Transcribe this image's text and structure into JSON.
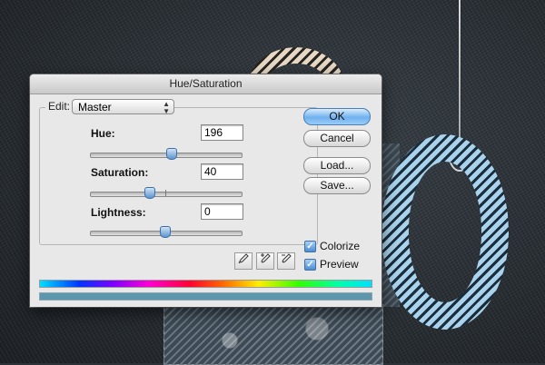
{
  "dialog": {
    "title": "Hue/Saturation",
    "edit_label": "Edit:",
    "edit_value": "Master",
    "hue": {
      "label": "Hue:",
      "value": "196",
      "slider_fraction": 0.54
    },
    "saturation": {
      "label": "Saturation:",
      "value": "40",
      "slider_fraction": 0.4
    },
    "lightness": {
      "label": "Lightness:",
      "value": "0",
      "slider_fraction": 0.5
    },
    "buttons": {
      "ok": "OK",
      "cancel": "Cancel",
      "load": "Load...",
      "save": "Save..."
    },
    "colorize": {
      "label": "Colorize",
      "checked": true
    },
    "preview": {
      "label": "Preview",
      "checked": true
    },
    "icons": [
      "eyedropper-icon",
      "eyedropper-plus-icon",
      "eyedropper-minus-icon"
    ]
  },
  "colors": {
    "accent": "#6fb1ef",
    "colorize_bar": "#5d97ad"
  }
}
